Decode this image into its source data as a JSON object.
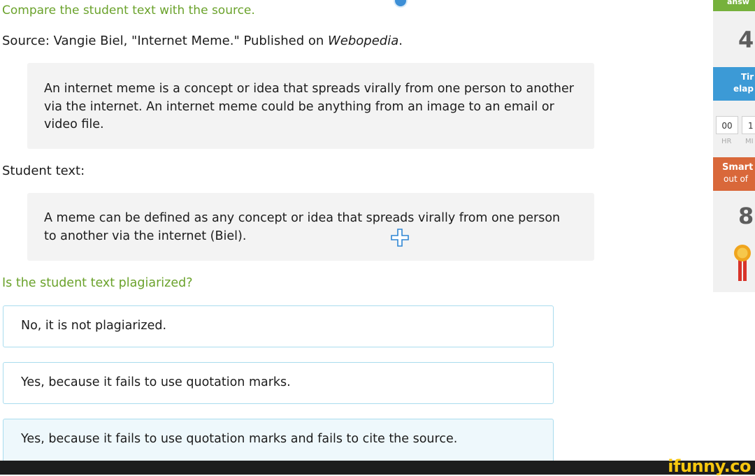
{
  "instruction": "Compare the student text with the source.",
  "source": {
    "prefix": "Source: Vangie Biel, \"Internet Meme.\" Published on ",
    "publication": "Webopedia",
    "suffix": "."
  },
  "source_text": "An internet meme is a concept or idea that spreads virally from one person to another via the internet. An internet meme could be anything from an image to an email or video file.",
  "student_label": "Student text:",
  "student_text": "A meme can be defined as any concept or idea that spreads virally from one person to another via the internet (Biel).",
  "question": "Is the student text plagiarized?",
  "choices": [
    {
      "label": "No, it is not plagiarized."
    },
    {
      "label": "Yes, because it fails to use quotation marks."
    },
    {
      "label": "Yes, because it fails to use quotation marks and fails to cite the source."
    }
  ],
  "sidebar": {
    "answered_tab": "answ",
    "answered_count": "4",
    "time_title": "Tir",
    "time_subtitle": "elap",
    "timer": {
      "hr": "00",
      "min": "1",
      "hr_label": "HR",
      "min_label": "MI"
    },
    "smart_title": "Smart",
    "smart_subtitle": "out of",
    "smart_score": "8"
  },
  "watermark": "ifunny.co",
  "colors": {
    "green": "#6aa22b",
    "blue": "#3c9ad6",
    "orange": "#d9683a",
    "choice_border": "#a9dcee"
  }
}
